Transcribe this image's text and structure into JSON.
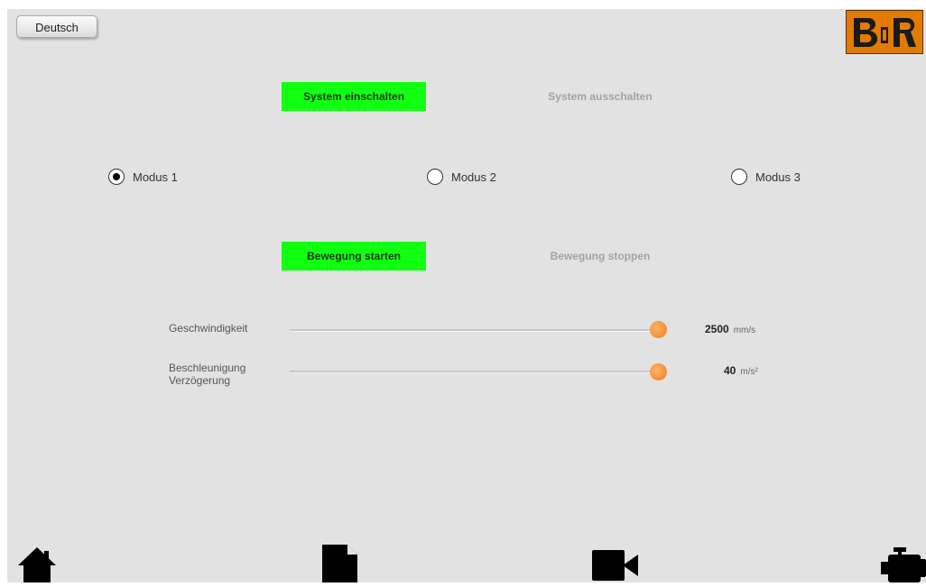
{
  "header": {
    "language_button": "Deutsch",
    "logo_text": "B&R"
  },
  "system": {
    "on_label": "System einschalten",
    "off_label": "System ausschalten",
    "state": "on"
  },
  "modes": {
    "items": [
      {
        "label": "Modus 1",
        "selected": true
      },
      {
        "label": "Modus 2",
        "selected": false
      },
      {
        "label": "Modus 3",
        "selected": false
      }
    ]
  },
  "motion": {
    "start_label": "Bewegung starten",
    "stop_label": "Bewegung stoppen",
    "state": "start"
  },
  "sliders": {
    "speed": {
      "label": "Geschwindigkeit",
      "value": "2500",
      "unit": "mm/s",
      "fraction": 1.0
    },
    "accel": {
      "label_line1": "Beschleunigung",
      "label_line2": "Verzögerung",
      "value": "40",
      "unit": "m/s²",
      "fraction": 1.0
    }
  },
  "nav": {
    "icons": [
      "home-icon",
      "document-icon",
      "video-camera-icon",
      "engine-icon"
    ]
  },
  "colors": {
    "active_button": "#11ff11",
    "slider_thumb": "#ec7f22",
    "logo_bg": "#e27b00",
    "background": "#e2e2e2"
  }
}
